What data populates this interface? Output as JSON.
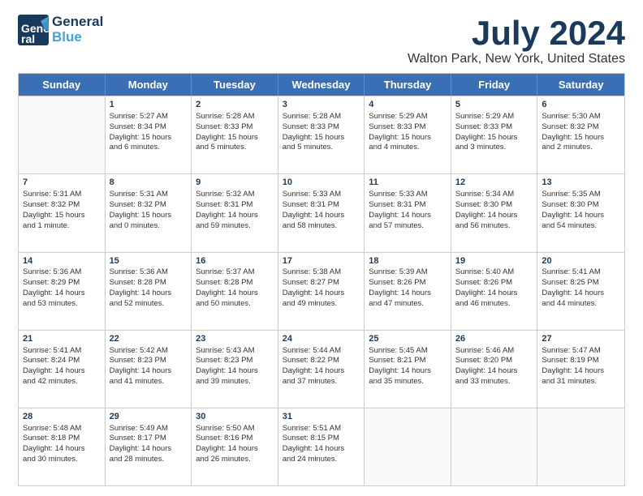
{
  "logo": {
    "line1": "General",
    "line2": "Blue"
  },
  "title": "July 2024",
  "location": "Walton Park, New York, United States",
  "days": [
    "Sunday",
    "Monday",
    "Tuesday",
    "Wednesday",
    "Thursday",
    "Friday",
    "Saturday"
  ],
  "weeks": [
    [
      {
        "day": "",
        "content": ""
      },
      {
        "day": "1",
        "content": "Sunrise: 5:27 AM\nSunset: 8:34 PM\nDaylight: 15 hours\nand 6 minutes."
      },
      {
        "day": "2",
        "content": "Sunrise: 5:28 AM\nSunset: 8:33 PM\nDaylight: 15 hours\nand 5 minutes."
      },
      {
        "day": "3",
        "content": "Sunrise: 5:28 AM\nSunset: 8:33 PM\nDaylight: 15 hours\nand 5 minutes."
      },
      {
        "day": "4",
        "content": "Sunrise: 5:29 AM\nSunset: 8:33 PM\nDaylight: 15 hours\nand 4 minutes."
      },
      {
        "day": "5",
        "content": "Sunrise: 5:29 AM\nSunset: 8:33 PM\nDaylight: 15 hours\nand 3 minutes."
      },
      {
        "day": "6",
        "content": "Sunrise: 5:30 AM\nSunset: 8:32 PM\nDaylight: 15 hours\nand 2 minutes."
      }
    ],
    [
      {
        "day": "7",
        "content": "Sunrise: 5:31 AM\nSunset: 8:32 PM\nDaylight: 15 hours\nand 1 minute."
      },
      {
        "day": "8",
        "content": "Sunrise: 5:31 AM\nSunset: 8:32 PM\nDaylight: 15 hours\nand 0 minutes."
      },
      {
        "day": "9",
        "content": "Sunrise: 5:32 AM\nSunset: 8:31 PM\nDaylight: 14 hours\nand 59 minutes."
      },
      {
        "day": "10",
        "content": "Sunrise: 5:33 AM\nSunset: 8:31 PM\nDaylight: 14 hours\nand 58 minutes."
      },
      {
        "day": "11",
        "content": "Sunrise: 5:33 AM\nSunset: 8:31 PM\nDaylight: 14 hours\nand 57 minutes."
      },
      {
        "day": "12",
        "content": "Sunrise: 5:34 AM\nSunset: 8:30 PM\nDaylight: 14 hours\nand 56 minutes."
      },
      {
        "day": "13",
        "content": "Sunrise: 5:35 AM\nSunset: 8:30 PM\nDaylight: 14 hours\nand 54 minutes."
      }
    ],
    [
      {
        "day": "14",
        "content": "Sunrise: 5:36 AM\nSunset: 8:29 PM\nDaylight: 14 hours\nand 53 minutes."
      },
      {
        "day": "15",
        "content": "Sunrise: 5:36 AM\nSunset: 8:28 PM\nDaylight: 14 hours\nand 52 minutes."
      },
      {
        "day": "16",
        "content": "Sunrise: 5:37 AM\nSunset: 8:28 PM\nDaylight: 14 hours\nand 50 minutes."
      },
      {
        "day": "17",
        "content": "Sunrise: 5:38 AM\nSunset: 8:27 PM\nDaylight: 14 hours\nand 49 minutes."
      },
      {
        "day": "18",
        "content": "Sunrise: 5:39 AM\nSunset: 8:26 PM\nDaylight: 14 hours\nand 47 minutes."
      },
      {
        "day": "19",
        "content": "Sunrise: 5:40 AM\nSunset: 8:26 PM\nDaylight: 14 hours\nand 46 minutes."
      },
      {
        "day": "20",
        "content": "Sunrise: 5:41 AM\nSunset: 8:25 PM\nDaylight: 14 hours\nand 44 minutes."
      }
    ],
    [
      {
        "day": "21",
        "content": "Sunrise: 5:41 AM\nSunset: 8:24 PM\nDaylight: 14 hours\nand 42 minutes."
      },
      {
        "day": "22",
        "content": "Sunrise: 5:42 AM\nSunset: 8:23 PM\nDaylight: 14 hours\nand 41 minutes."
      },
      {
        "day": "23",
        "content": "Sunrise: 5:43 AM\nSunset: 8:23 PM\nDaylight: 14 hours\nand 39 minutes."
      },
      {
        "day": "24",
        "content": "Sunrise: 5:44 AM\nSunset: 8:22 PM\nDaylight: 14 hours\nand 37 minutes."
      },
      {
        "day": "25",
        "content": "Sunrise: 5:45 AM\nSunset: 8:21 PM\nDaylight: 14 hours\nand 35 minutes."
      },
      {
        "day": "26",
        "content": "Sunrise: 5:46 AM\nSunset: 8:20 PM\nDaylight: 14 hours\nand 33 minutes."
      },
      {
        "day": "27",
        "content": "Sunrise: 5:47 AM\nSunset: 8:19 PM\nDaylight: 14 hours\nand 31 minutes."
      }
    ],
    [
      {
        "day": "28",
        "content": "Sunrise: 5:48 AM\nSunset: 8:18 PM\nDaylight: 14 hours\nand 30 minutes."
      },
      {
        "day": "29",
        "content": "Sunrise: 5:49 AM\nSunset: 8:17 PM\nDaylight: 14 hours\nand 28 minutes."
      },
      {
        "day": "30",
        "content": "Sunrise: 5:50 AM\nSunset: 8:16 PM\nDaylight: 14 hours\nand 26 minutes."
      },
      {
        "day": "31",
        "content": "Sunrise: 5:51 AM\nSunset: 8:15 PM\nDaylight: 14 hours\nand 24 minutes."
      },
      {
        "day": "",
        "content": ""
      },
      {
        "day": "",
        "content": ""
      },
      {
        "day": "",
        "content": ""
      }
    ]
  ]
}
